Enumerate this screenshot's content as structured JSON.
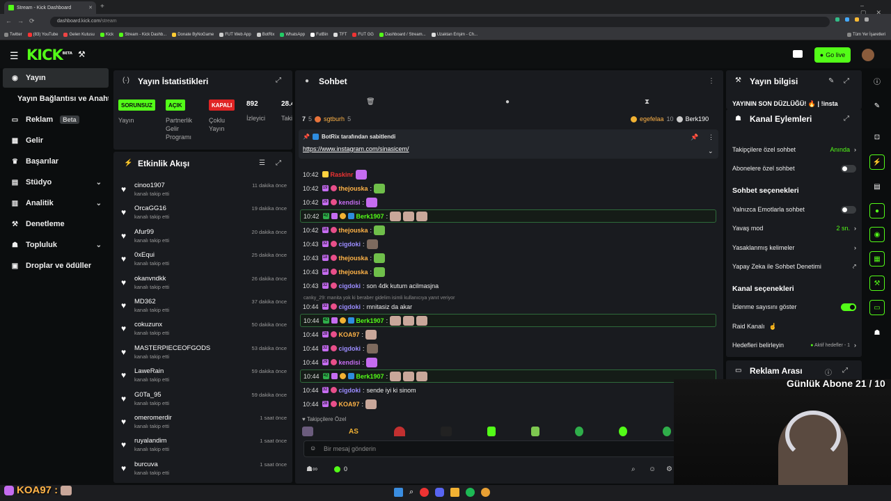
{
  "browser": {
    "tab_title": "Stream - Kick Dashboard",
    "url_prefix": "dashboard.kick.com",
    "url_path": "/stream",
    "bookmarks": [
      "Twitter",
      "(83) YouTube",
      "Gelen Kutusu",
      "Kick",
      "Stream - Kick Dashb...",
      "Donate ByNoGame",
      "FUT Web App",
      "BotRix",
      "WhatsApp",
      "FutBin",
      "TFT",
      "FUT GG",
      "Dashboard / Stream...",
      "Uzaktan Erişim - Ch..."
    ],
    "all_bookmarks": "Tüm Yer İşaretleri"
  },
  "header": {
    "logo": "KICK",
    "logo_sup": "BETA",
    "go_live": "Go live"
  },
  "nav": [
    {
      "label": "Yayın",
      "active": true
    },
    {
      "label": "Yayın Bağlantısı ve Anahtarı"
    },
    {
      "label": "Reklam",
      "badge": "Beta"
    },
    {
      "label": "Gelir"
    },
    {
      "label": "Başarılar"
    },
    {
      "label": "Stüdyo"
    },
    {
      "label": "Analitik"
    },
    {
      "label": "Denetleme"
    },
    {
      "label": "Topluluk"
    },
    {
      "label": "Droplar ve ödüller"
    }
  ],
  "stats": {
    "title": "Yayın İstatistikleri",
    "badge1": "SORUNSUZ",
    "label1": "Yayın",
    "badge2": "AÇIK",
    "label2a": "Partnerlik",
    "label2b": "Gelir",
    "label2c": "Programı",
    "badge3": "KAPALI",
    "label3a": "Çoklu",
    "label3b": "Yayın",
    "viewers": "892",
    "viewers_label": "İzleyici",
    "followers": "28.4",
    "followers_label": "Taki"
  },
  "activity": {
    "title": "Etkinlik Akışı",
    "sub": "kanalı takip etti",
    "items": [
      {
        "name": "cinoo1907",
        "time": "11 dakika önce"
      },
      {
        "name": "OrcaGG16",
        "time": "19 dakika önce"
      },
      {
        "name": "Afur99",
        "time": "20 dakika önce"
      },
      {
        "name": "0xEqui",
        "time": "25 dakika önce"
      },
      {
        "name": "okanvndkk",
        "time": "26 dakika önce"
      },
      {
        "name": "MD362",
        "time": "37 dakika önce"
      },
      {
        "name": "cokuzunx",
        "time": "50 dakika önce"
      },
      {
        "name": "MASTERPIECEOFGODS",
        "time": "53 dakika önce"
      },
      {
        "name": "LaweRain",
        "time": "59 dakika önce"
      },
      {
        "name": "G0Ta_95",
        "time": "59 dakika önce"
      },
      {
        "name": "omeromerdir",
        "time": "1 saat önce"
      },
      {
        "name": "ruyalandim",
        "time": "1 saat önce"
      },
      {
        "name": "burcuva",
        "time": "1 saat önce"
      }
    ]
  },
  "chat": {
    "title": "Sohbet",
    "top_left_num": "7",
    "top_left_sub": "5",
    "top_user": "sgtburh",
    "top_user_sub": "5",
    "top_right_user": "egefelaa",
    "top_right_sub": "10",
    "top_right_user2": "Berk190",
    "pinned_by": "BotRix tarafından sabitlendi",
    "pinned_link": "https://www.instagram.com/sinasicem/",
    "reply_context": "canky_29: manita yok ki beraber gidelim isimli kullanıcıya yanıt veriyor",
    "followers_only_label": "Takipçilere Özel",
    "placeholder": "Bir mesaj gönderin",
    "viewer_count": "0",
    "messages": [
      {
        "time": "10:42",
        "badge": "19",
        "user": "thejouska",
        "color": "#ffb347",
        "text": ""
      },
      {
        "time": "10:42",
        "badge": "29",
        "user": "kendisi",
        "color": "#c56cf0",
        "text": ""
      },
      {
        "time": "10:42",
        "badge": "42",
        "user": "Berk1907",
        "color": "#53fc18",
        "text": "",
        "hl": true
      },
      {
        "time": "10:42",
        "badge": "18",
        "user": "thejouska",
        "color": "#ffb347",
        "text": ""
      },
      {
        "time": "10:43",
        "badge": "32",
        "user": "cigdoki",
        "color": "#9b8cff",
        "text": ""
      },
      {
        "time": "10:43",
        "badge": "18",
        "user": "thejouska",
        "color": "#ffb347",
        "text": ""
      },
      {
        "time": "10:43",
        "badge": "18",
        "user": "thejouska",
        "color": "#ffb347",
        "text": ""
      },
      {
        "time": "10:43",
        "badge": "32",
        "user": "cigdoki",
        "color": "#9b8cff",
        "text": "son 4dk kutum acilmasjna"
      },
      {
        "time": "10:44",
        "badge": "32",
        "user": "cigdoki",
        "color": "#9b8cff",
        "text": "mnitasiz da akar"
      },
      {
        "time": "10:44",
        "badge": "42",
        "user": "Berk1907",
        "color": "#53fc18",
        "text": "",
        "hl": true
      },
      {
        "time": "10:44",
        "badge": "28",
        "user": "KOA97",
        "color": "#ffb347",
        "text": ""
      },
      {
        "time": "10:44",
        "badge": "32",
        "user": "cigdoki",
        "color": "#9b8cff",
        "text": ""
      },
      {
        "time": "10:44",
        "badge": "29",
        "user": "kendisi",
        "color": "#c56cf0",
        "text": ""
      },
      {
        "time": "10:44",
        "badge": "42",
        "user": "Berk1907",
        "color": "#53fc18",
        "text": "",
        "hl": true
      },
      {
        "time": "10:44",
        "badge": "32",
        "user": "cigdoki",
        "color": "#9b8cff",
        "text": "sende iyi ki sinom"
      },
      {
        "time": "10:44",
        "badge": "28",
        "user": "KOA97",
        "color": "#ffb347",
        "text": ""
      }
    ]
  },
  "stream_info": {
    "title": "Yayın bilgisi",
    "text": "YAYININ SON DÜZLÜĞÜ! 🔥 | !insta"
  },
  "channel_actions": {
    "title": "Kanal Eylemleri",
    "followers_chat": "Takipçilere özel sohbet",
    "followers_chat_value": "Anında",
    "subs_chat": "Abonelere özel sohbet",
    "chat_options": "Sohbet seçenekleri",
    "emote_only": "Yalnızca Emotlarla sohbet",
    "slow_mode": "Yavaş mod",
    "slow_mode_value": "2 sn.",
    "banned_words": "Yasaklanmış kelimeler",
    "ai_moderation": "Yapay Zeka ile Sohbet Denetimi",
    "channel_options": "Kanal seçenekleri",
    "show_viewers": "İzlenme sayısını göster",
    "raid": "Raid Kanalı",
    "goals": "Hedefleri belirleyin",
    "goals_value": "Aktif hedefler - 1"
  },
  "ad_break": {
    "title": "Reklam Arası"
  },
  "overlay": {
    "sub_goal": "Günlük Abone 21 / 10",
    "bottom_user": "KOA97 :"
  },
  "colors": {
    "accent": "#53fc18",
    "panel": "#191b1f",
    "bg": "#0b0d0e"
  }
}
